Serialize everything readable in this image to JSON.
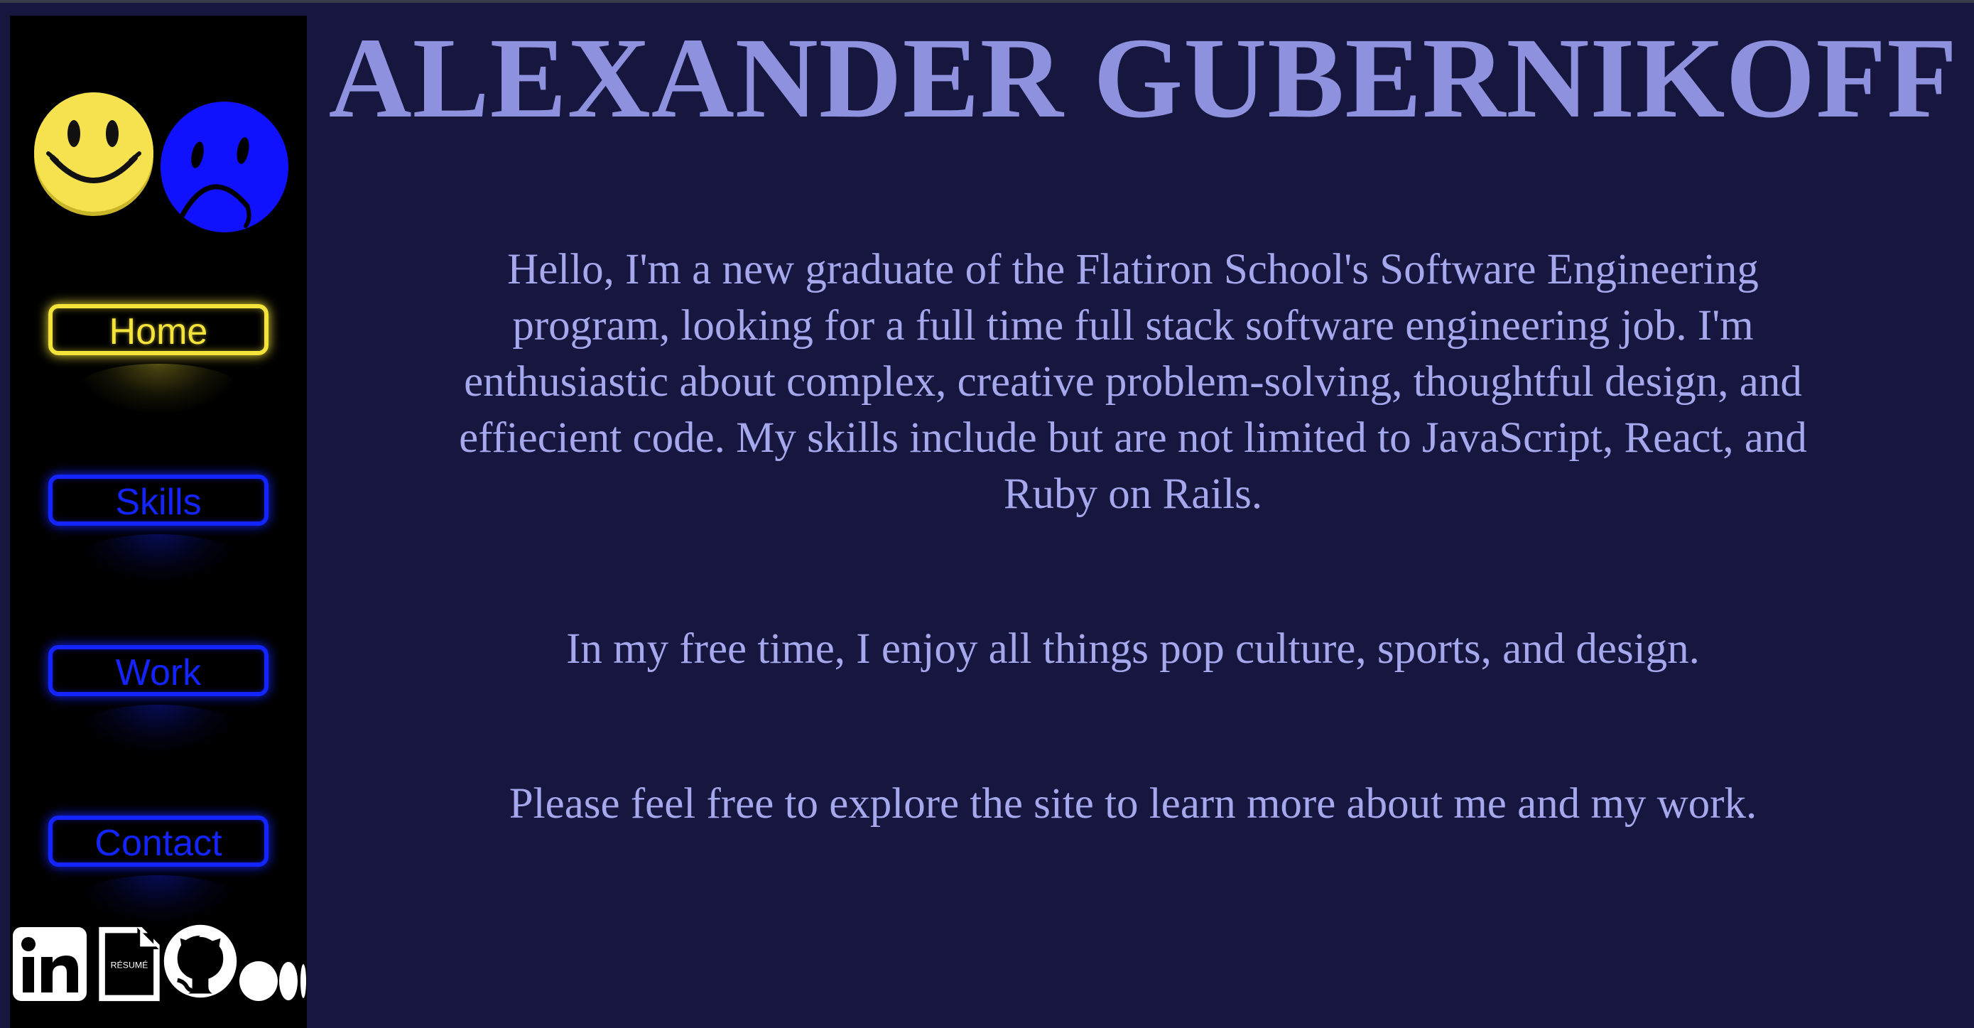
{
  "header": {
    "name": "ALEXANDER GUBERNIKOFF"
  },
  "sidebar": {
    "logos": [
      "smiley-face-icon",
      "frowning-face-icon"
    ],
    "nav": [
      {
        "label": "Home",
        "active": true
      },
      {
        "label": "Skills",
        "active": false
      },
      {
        "label": "Work",
        "active": false
      },
      {
        "label": "Contact",
        "active": false
      }
    ],
    "social": {
      "linkedin": "linkedin-icon",
      "resume_label": "RÉSUMÉ",
      "github": "github-icon",
      "medium": "medium-icon"
    }
  },
  "main": {
    "paragraphs": [
      "Hello, I'm a new graduate of the Flatiron School's Software Engineering program, looking for a full time full stack software engineering job. I'm enthusiastic about complex, creative problem-solving, thoughtful design, and effiecient code. My skills include but are not limited to JavaScript, React, and Ruby on Rails.",
      "In my free time, I enjoy all things pop culture, sports, and design.",
      "Please feel free to explore the site to learn more about me and my work."
    ]
  },
  "colors": {
    "background": "#16163f",
    "sidebar": "#000000",
    "title": "#8e91dd",
    "body_text": "#a6a8ee",
    "active_yellow": "#f3e33a",
    "inactive_blue": "#1424ff"
  }
}
